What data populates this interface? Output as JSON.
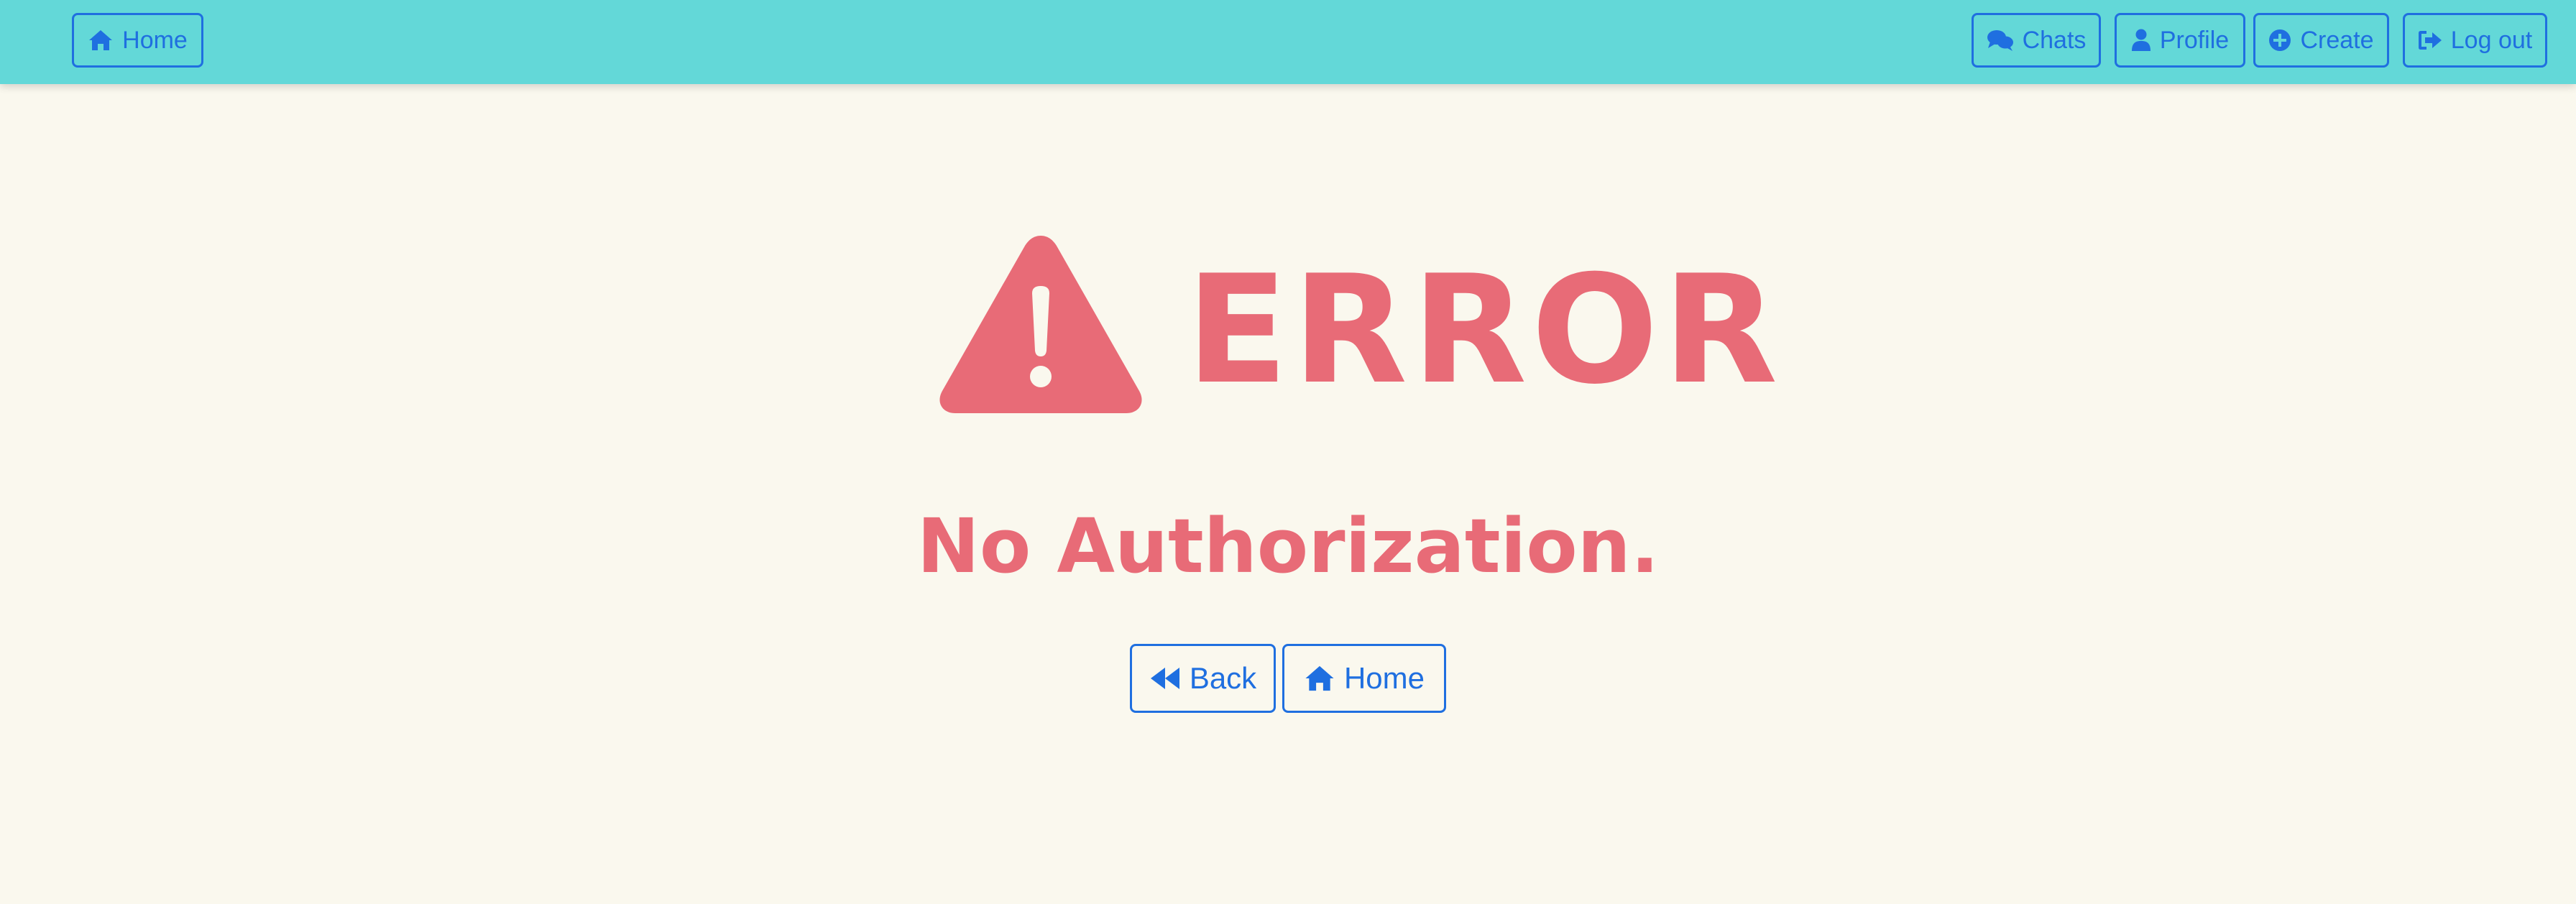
{
  "navbar": {
    "home_label": "Home",
    "chats_label": "Chats",
    "profile_label": "Profile",
    "create_label": "Create",
    "logout_label": "Log out",
    "background_color": "#63d8d8",
    "accent_color": "#1f6fe0"
  },
  "error": {
    "title": "ERROR",
    "message": "No Authorization.",
    "icon": "warning-triangle-icon",
    "color": "#e86b77"
  },
  "actions": {
    "back_label": "Back",
    "home_label": "Home"
  },
  "page": {
    "background_color": "#faf8ee"
  }
}
